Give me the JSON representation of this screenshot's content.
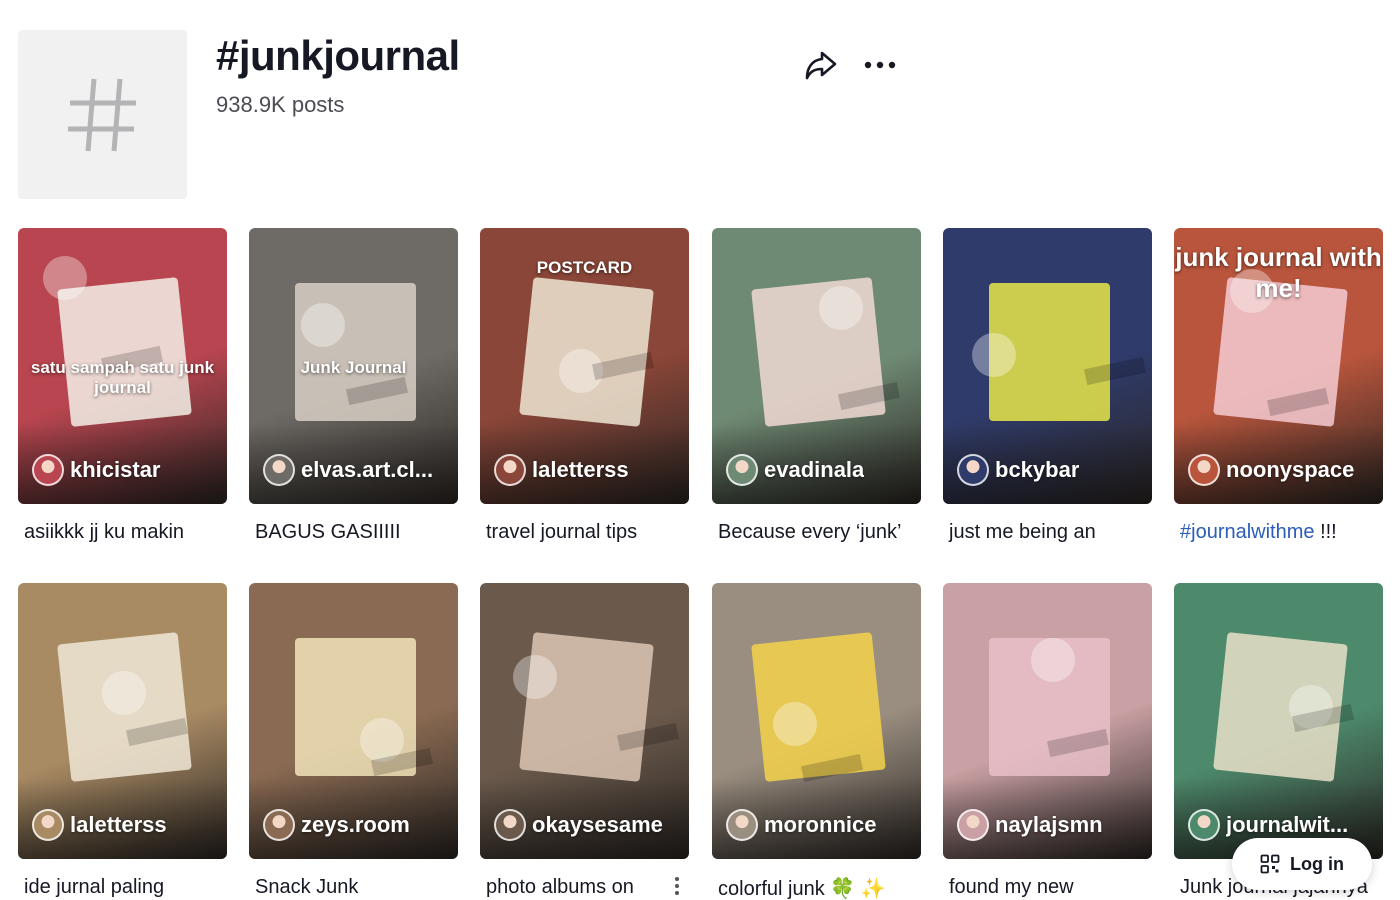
{
  "hashtag": {
    "title": "#junkjournal",
    "post_count": "938.9K posts"
  },
  "actions": {
    "share_icon": "share-arrow-icon",
    "more_icon": "more-horizontal-icon"
  },
  "videos": [
    {
      "author": "khicistar",
      "caption": "asiikkk jj ku makin",
      "overlay": "satu sampah satu junk journal",
      "bg": "#b8454f",
      "accent": "#f3f0e8"
    },
    {
      "author": "elvas.art.cl...",
      "caption": "BAGUS GASIIIII",
      "overlay": "Junk Journal",
      "bg": "#6e6b66",
      "accent": "#d8cfc4"
    },
    {
      "author": "laletterss",
      "caption": "travel journal tips",
      "overlay": "POSTCARD",
      "bg": "#8a4638",
      "accent": "#efe6d4"
    },
    {
      "author": "evadinala",
      "caption": "Because every ‘junk’",
      "overlay": "",
      "bg": "#6f8a74",
      "accent": "#f1d9d4"
    },
    {
      "author": "bckybar",
      "caption": "just me being an",
      "overlay": "",
      "bg": "#2f3b6b",
      "accent": "#e8e84a"
    },
    {
      "author": "noonyspace",
      "caption_hashtag": "#journalwithme",
      "caption": " !!!",
      "overlay": "junk journal with me!",
      "bg": "#b8553c",
      "accent": "#f5cbd2"
    },
    {
      "author": "laletterss",
      "caption": "ide jurnal paling",
      "overlay": "",
      "bg": "#a88a63",
      "accent": "#f0e8d6"
    },
    {
      "author": "zeys.room",
      "caption": "Snack Junk",
      "overlay": "",
      "bg": "#8a6a52",
      "accent": "#f1e3b8"
    },
    {
      "author": "okaysesame",
      "caption": "photo albums on",
      "overlay": "",
      "bg": "#6b5a4c",
      "accent": "#dcc6b4"
    },
    {
      "author": "moronnice",
      "caption": "colorful junk 🍀 ✨",
      "overlay": "",
      "bg": "#9a8e80",
      "accent": "#f3d24b"
    },
    {
      "author": "naylajsmn",
      "caption": "found my new",
      "overlay": "",
      "bg": "#c9a0a3",
      "accent": "#e9c0c8"
    },
    {
      "author": "journalwit...",
      "caption": "Junk journal jajannya",
      "overlay": "",
      "bg": "#4d8a6c",
      "accent": "#e9e0c8"
    }
  ],
  "login": {
    "label": "Log in",
    "icon": "qr-code-icon"
  }
}
